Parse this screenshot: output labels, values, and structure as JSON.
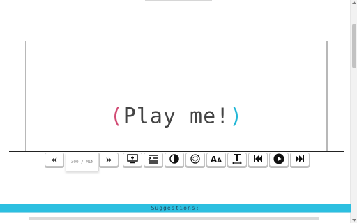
{
  "display": {
    "open_paren": "(",
    "text": "Play me!",
    "close_paren": ")",
    "accent_open_color": "#d14a73",
    "accent_close_color": "#22b7d6"
  },
  "toolbar": {
    "slower": {
      "icon": "double-chevron-left-icon",
      "glyph": "«"
    },
    "speed": {
      "value": "300 / MIN"
    },
    "faster": {
      "icon": "double-chevron-right-icon",
      "glyph": "»"
    },
    "add_text": {
      "icon": "monitor-add-icon"
    },
    "list_format": {
      "icon": "list-format-icon"
    },
    "contrast": {
      "icon": "contrast-icon"
    },
    "focus": {
      "icon": "target-icon"
    },
    "font_size": {
      "icon": "font-size-icon",
      "big": "A",
      "small": "A"
    },
    "text_width": {
      "icon": "text-width-icon"
    },
    "previous": {
      "icon": "skip-previous-icon"
    },
    "play": {
      "icon": "play-circle-icon"
    },
    "next": {
      "icon": "skip-next-icon"
    }
  },
  "footer": {
    "label": "Suggestions:"
  },
  "colors": {
    "accent_bar": "#2cbfe0"
  }
}
